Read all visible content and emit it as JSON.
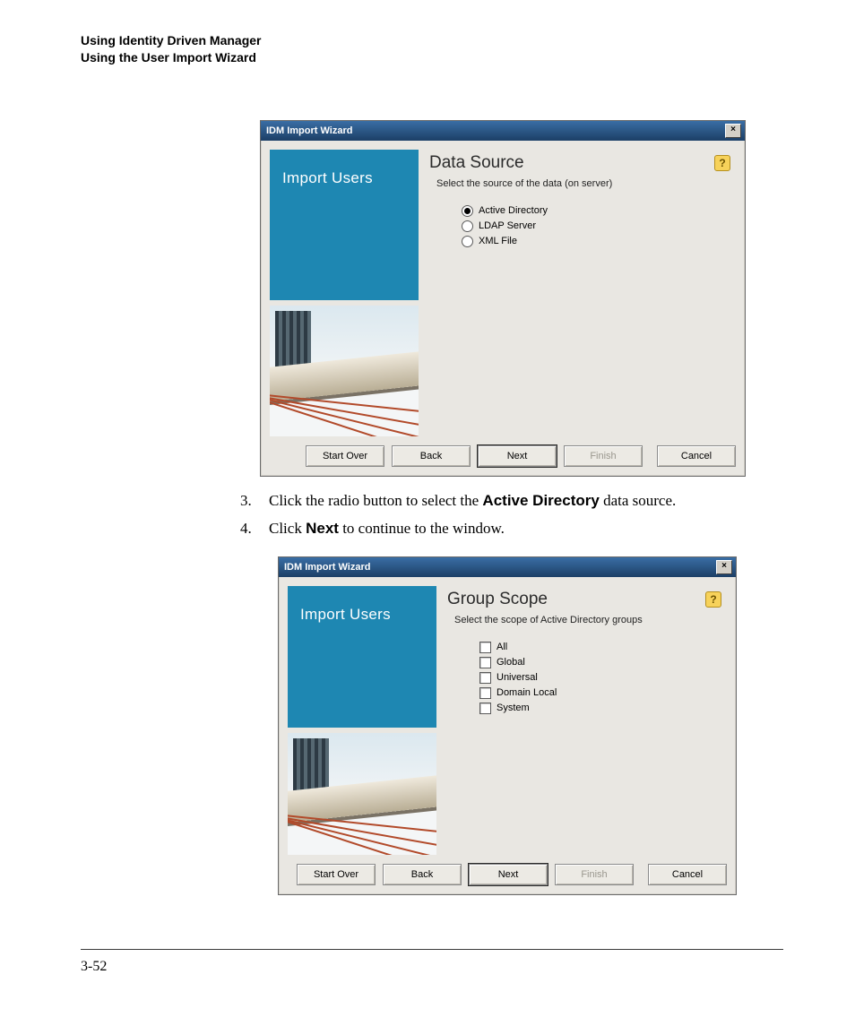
{
  "header": {
    "line1": "Using Identity Driven Manager",
    "line2": "Using the User Import Wizard"
  },
  "steps": [
    {
      "num": "3.",
      "pre": "Click the radio button to select the ",
      "bold": "Active Directory",
      "post": " data source."
    },
    {
      "num": "4.",
      "pre": "Click ",
      "bold": "Next",
      "post": " to continue to the                    window."
    }
  ],
  "wizard1": {
    "title": "IDM Import Wizard",
    "side_label": "Import Users",
    "heading": "Data Source",
    "subheading": "Select the source of the data (on server)",
    "options": [
      {
        "label": "Active Directory",
        "selected": true
      },
      {
        "label": "LDAP Server",
        "selected": false
      },
      {
        "label": "XML File",
        "selected": false
      }
    ],
    "buttons": {
      "start_over": "Start Over",
      "back": "Back",
      "next": "Next",
      "finish": "Finish",
      "cancel": "Cancel"
    }
  },
  "wizard2": {
    "title": "IDM Import Wizard",
    "side_label": "Import Users",
    "heading": "Group Scope",
    "subheading": "Select the scope of Active Directory groups",
    "options": [
      {
        "label": "All"
      },
      {
        "label": "Global"
      },
      {
        "label": "Universal"
      },
      {
        "label": "Domain Local"
      },
      {
        "label": "System"
      }
    ],
    "buttons": {
      "start_over": "Start Over",
      "back": "Back",
      "next": "Next",
      "finish": "Finish",
      "cancel": "Cancel"
    }
  },
  "page_number": "3-52",
  "help_glyph": "?"
}
